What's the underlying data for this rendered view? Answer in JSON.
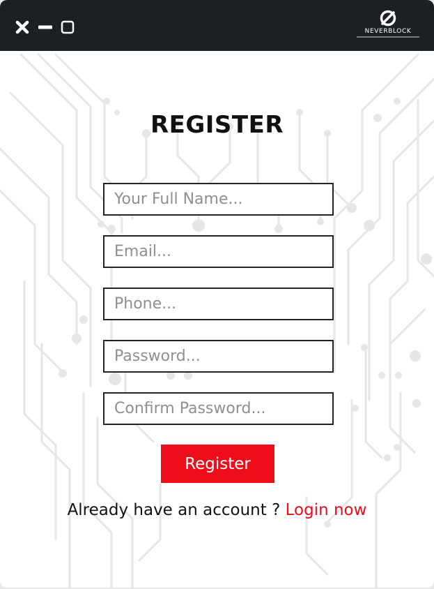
{
  "window": {
    "controls": {
      "close_icon": "close-icon",
      "minimize_icon": "minimize-icon",
      "maximize_icon": "maximize-icon"
    },
    "brand": {
      "name": "NEVERBLOCK",
      "logo_icon": "neverblock-logo"
    }
  },
  "form": {
    "title": "REGISTER",
    "fields": {
      "full_name": {
        "placeholder": "Your Full Name...",
        "value": ""
      },
      "email": {
        "placeholder": "Email...",
        "value": ""
      },
      "phone": {
        "placeholder": "Phone...",
        "value": ""
      },
      "password": {
        "placeholder": "Password...",
        "value": ""
      },
      "confirm_password": {
        "placeholder": "Confirm Password...",
        "value": ""
      }
    },
    "register_button": "Register",
    "login_prompt": "Already have an account ? ",
    "login_link": "Login now"
  },
  "colors": {
    "titlebar": "#1c1f23",
    "accent": "#ee0d1a",
    "circuit": "#e3e3e3",
    "text": "#111111",
    "placeholder": "#8f8f8f"
  }
}
